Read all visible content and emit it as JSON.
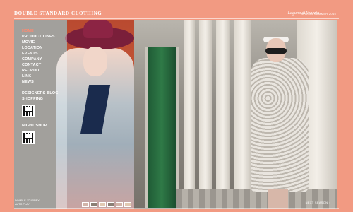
{
  "header": {
    "brand": "DOUBLE STANDARD CLOTHING",
    "season": "SPRING SUMMER 2015",
    "season_title": "Laguna di Venezia"
  },
  "nav": {
    "items": [
      {
        "label": "HOME",
        "active": true
      },
      {
        "label": "PRODUCT LINES"
      },
      {
        "label": "MOVIE"
      },
      {
        "label": "LOCATION"
      },
      {
        "label": "EVENTS"
      },
      {
        "label": "COMPANY"
      },
      {
        "label": "CONTACT"
      },
      {
        "label": "RECRUIT"
      },
      {
        "label": "LINK"
      },
      {
        "label": "NEWS"
      }
    ],
    "group1": {
      "items": [
        "DESIGNERS BLOG",
        "SHOPPING"
      ]
    },
    "group2": {
      "items": [
        "NIGHT SHOP"
      ]
    }
  },
  "panel_bottom": {
    "line1": "DOUBLE JOURNEY",
    "line2": "AUTO PLAY"
  },
  "footer": {
    "next_label": "NEXT SEASON",
    "next_icon": "chevron-right-icon"
  },
  "colors": {
    "background": "#f29a82",
    "active_nav": "#ff8a70"
  }
}
